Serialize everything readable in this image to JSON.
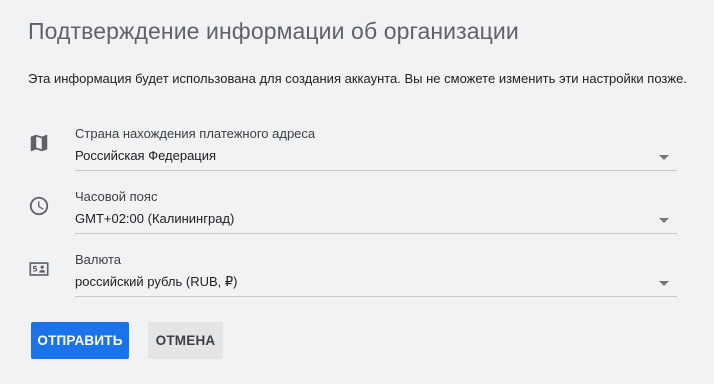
{
  "header": {
    "title": "Подтверждение информации об организации",
    "description": "Эта информация будет использована для создания аккаунта. Вы не сможете изменить эти настройки позже."
  },
  "fields": [
    {
      "icon": "map-icon",
      "label": "Страна нахождения платежного адреса",
      "value": "Российская Федерация"
    },
    {
      "icon": "clock-icon",
      "label": "Часовой пояс",
      "value": "GMT+02:00 (Калининград)"
    },
    {
      "icon": "currency-icon",
      "label": "Валюта",
      "value": "российский рубль (RUB, ₽)"
    }
  ],
  "actions": {
    "submit_label": "ОТПРАВИТЬ",
    "cancel_label": "ОТМЕНА"
  },
  "colors": {
    "primary": "#1a73e8",
    "background": "#f1f2f4",
    "secondary_button": "#e4e5e7"
  }
}
